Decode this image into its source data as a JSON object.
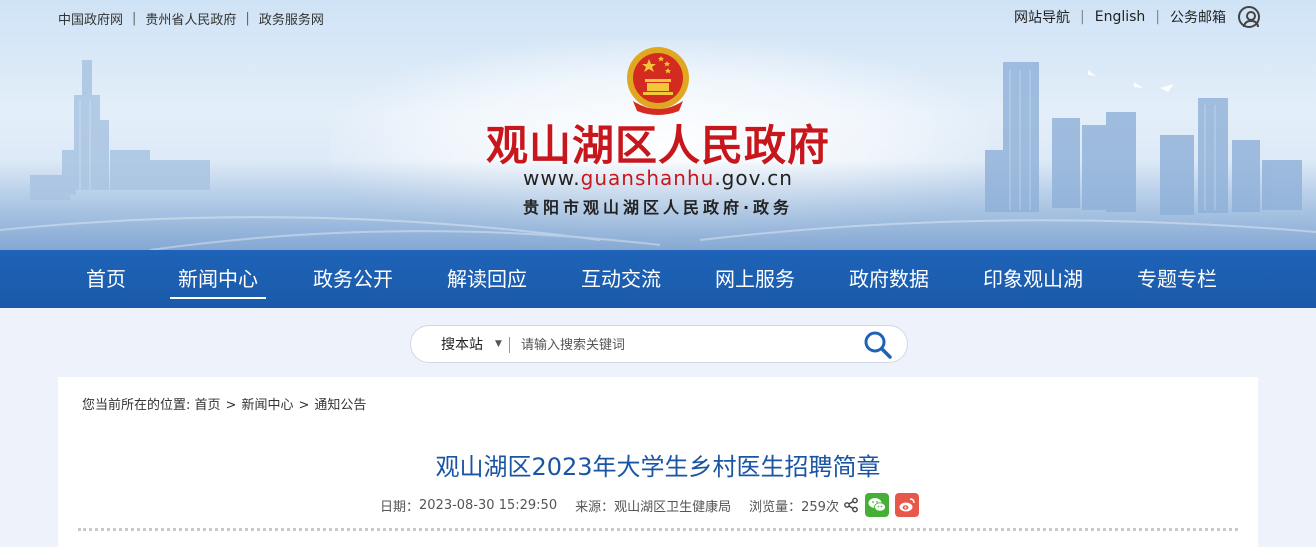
{
  "top_links": [
    "中国政府网",
    "贵州省人民政府",
    "政务服务网"
  ],
  "top_right": {
    "links": [
      "网站导航",
      "English",
      "公务邮箱"
    ],
    "user_icon": "user-circle-icon"
  },
  "header": {
    "title": "观山湖区人民政府",
    "url_prefix": "www.",
    "url_domain": "guanshanhu",
    "url_suffix": ".gov.cn",
    "subtitle": "贵阳市观山湖区人民政府·政务",
    "emblem_icon": "national-emblem-icon"
  },
  "nav": {
    "items": [
      "首页",
      "新闻中心",
      "政务公开",
      "解读回应",
      "互动交流",
      "网上服务",
      "政府数据",
      "印象观山湖",
      "专题专栏"
    ],
    "active_index": 1
  },
  "search": {
    "scope": "搜本站",
    "placeholder": "请输入搜索关键词",
    "icon": "search-icon"
  },
  "breadcrumb": {
    "prefix": "您当前所在的位置:",
    "items": [
      "首页",
      "新闻中心",
      "通知公告"
    ],
    "separator": ">"
  },
  "article": {
    "title": "观山湖区2023年大学生乡村医生招聘简章",
    "date_label": "日期：",
    "date": "2023-08-30 15:29:50",
    "source_label": "来源：",
    "source": "观山湖区卫生健康局",
    "views_label": "浏览量：",
    "views": "259次",
    "share_icons": [
      "share-icon",
      "wechat-icon",
      "weibo-icon"
    ]
  },
  "colors": {
    "nav_bg": "#1e63b8",
    "title_red": "#c8161d",
    "article_title": "#1a55a4",
    "wechat_green": "#45b035",
    "weibo_red": "#e8584a"
  }
}
